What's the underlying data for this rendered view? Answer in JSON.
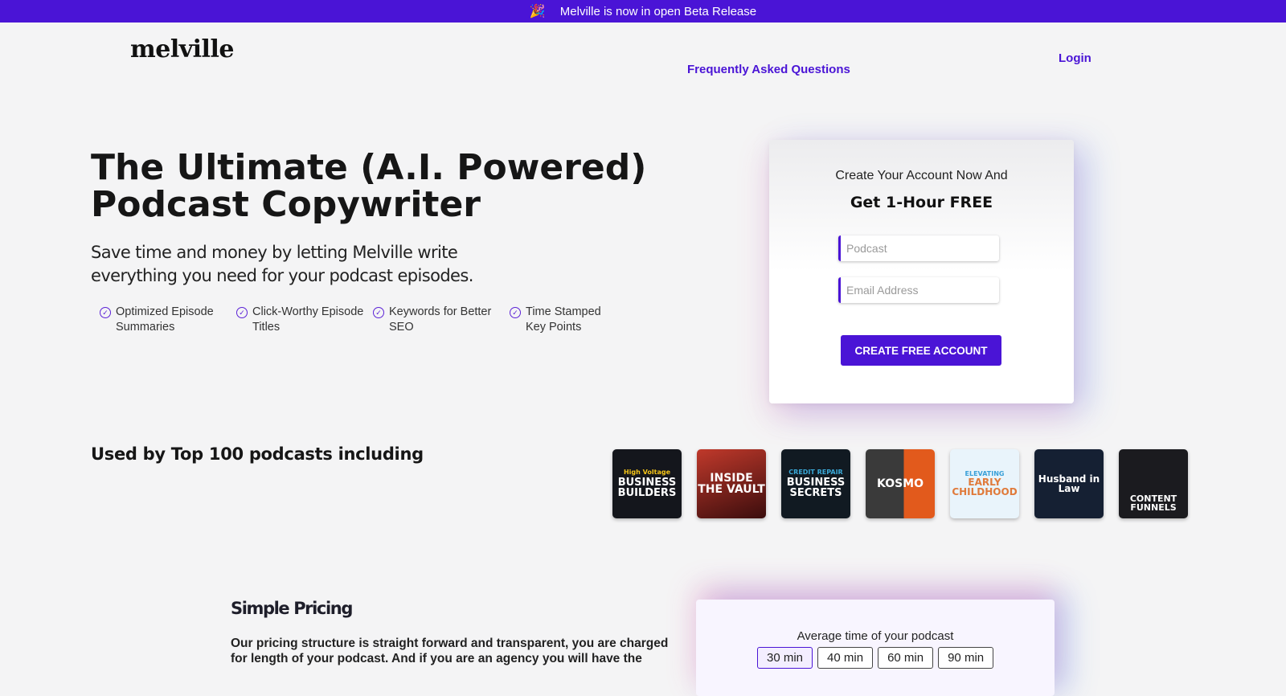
{
  "banner": {
    "icon": "party-popper-icon",
    "text": "Melville is now in open Beta Release"
  },
  "nav": {
    "logo": "melville",
    "faq": "Frequently Asked Questions",
    "login": "Login"
  },
  "hero": {
    "title": "The Ultimate (A.I. Powered) Podcast Copywriter",
    "subtitle": "Save time and money by letting Melville write everything you need for your podcast episodes.",
    "features": [
      {
        "label": "Optimized Episode Summaries"
      },
      {
        "label": "Click-Worthy Episode Titles"
      },
      {
        "label": "Keywords for Better SEO"
      },
      {
        "label": "Time Stamped Key Points"
      }
    ]
  },
  "signup": {
    "line1": "Create Your Account Now And",
    "line2": "Get 1-Hour FREE",
    "podcast_placeholder": "Podcast",
    "email_placeholder": "Email Address",
    "cta": "CREATE FREE ACCOUNT"
  },
  "used_by": {
    "title": "Used by Top 100 podcasts including",
    "podcasts": [
      {
        "top": "High Voltage",
        "text": "BUSINESS BUILDERS"
      },
      {
        "top": "INSIDE",
        "text": "THE VAULT"
      },
      {
        "top": "CREDIT REPAIR",
        "text": "BUSINESS SECRETS"
      },
      {
        "top": "",
        "text": "KOSMO"
      },
      {
        "top": "ELEVATING",
        "text": "EARLY CHILDHOOD"
      },
      {
        "top": "",
        "text": "Husband in Law"
      },
      {
        "top": "",
        "text": "CONTENT FUNNELS"
      }
    ]
  },
  "pricing": {
    "title": "Simple Pricing",
    "text": "Our pricing structure is straight forward and transparent, you are charged for length of your podcast. And if you are an agency you will have the",
    "question": "Average time of your podcast",
    "durations": [
      "30 min",
      "40 min",
      "60 min",
      "90 min"
    ],
    "selected": "30 min"
  },
  "colors": {
    "brand": "#4a14d6",
    "background": "#f4f4f5"
  }
}
